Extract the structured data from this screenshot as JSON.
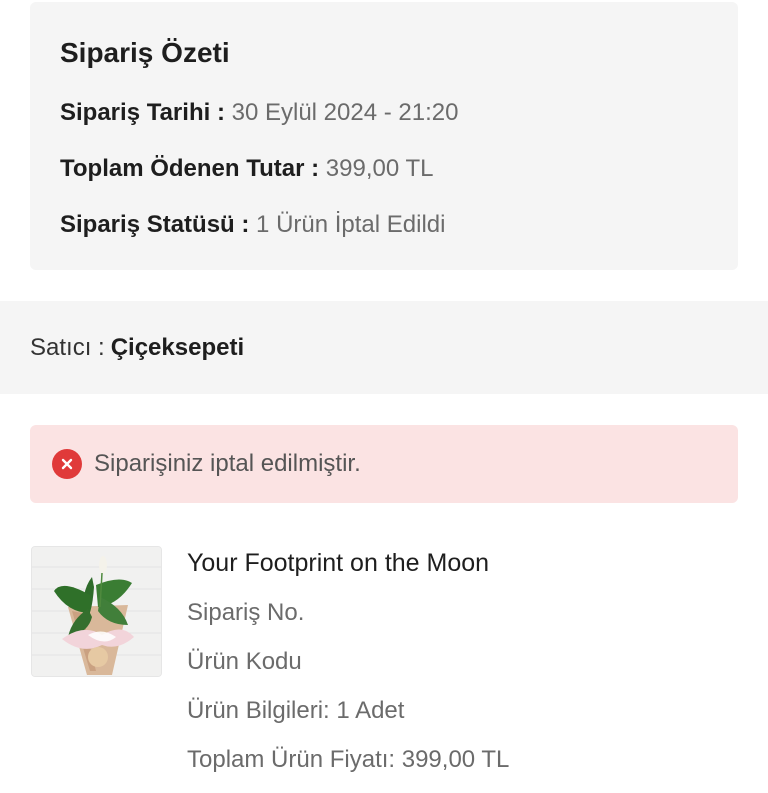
{
  "summary": {
    "title": "Sipariş Özeti",
    "date_label": "Sipariş Tarihi :",
    "date_value": "30 Eylül 2024 - 21:20",
    "total_label": "Toplam Ödenen Tutar :",
    "total_value": "399,00 TL",
    "status_label": "Sipariş Statüsü :",
    "status_value": "1 Ürün İptal Edildi"
  },
  "seller": {
    "label": "Satıcı :",
    "name": "Çiçeksepeti"
  },
  "alert": {
    "icon": "close-circle-icon",
    "message": "Siparişiniz iptal edilmiştir.",
    "color": "#e03a3a",
    "background": "#fbe3e3"
  },
  "product": {
    "image": "plant-bouquet-image",
    "title": "Your Footprint on the Moon",
    "order_no_label": "Sipariş No.",
    "product_code_label": "Ürün Kodu",
    "info": "Ürün Bilgileri: 1 Adet",
    "price": "Toplam Ürün Fiyatı: 399,00 TL"
  }
}
